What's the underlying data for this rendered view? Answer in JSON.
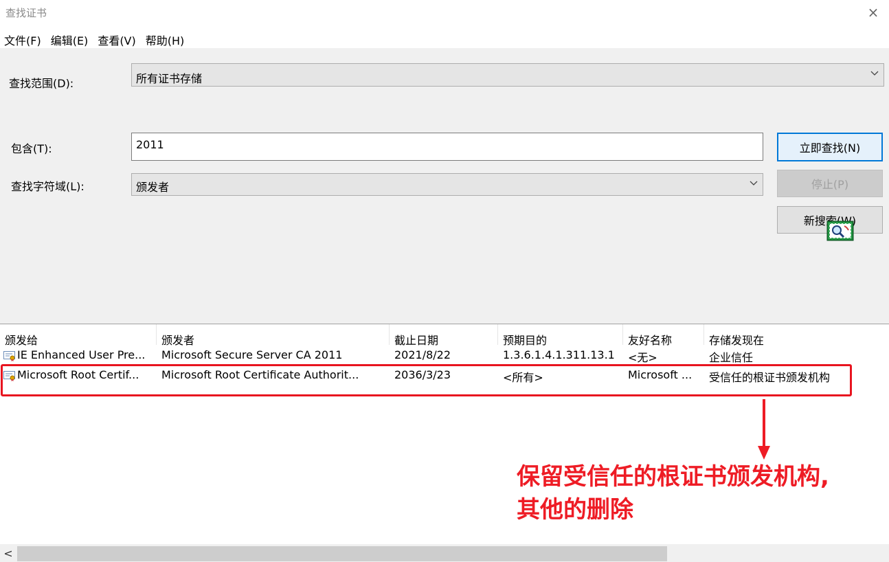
{
  "window": {
    "title": "查找证书",
    "close_glyph": "×"
  },
  "menu": [
    "文件(F)",
    "编辑(E)",
    "查看(V)",
    "帮助(H)"
  ],
  "search": {
    "scope_label": "查找范围(D):",
    "scope_value": "所有证书存储",
    "contains_label": "包含(T):",
    "contains_value": "2011",
    "field_label": "查找字符域(L):",
    "field_value": "颁发者"
  },
  "buttons": {
    "find_now": "立即查找(N)",
    "stop": "停止(P)",
    "new_search": "新搜索(W)"
  },
  "table": {
    "columns": [
      "颁发给",
      "颁发者",
      "截止日期",
      "预期目的",
      "友好名称",
      "存储发现在"
    ],
    "rows": [
      [
        "IE Enhanced User Pre...",
        "Microsoft Secure Server CA 2011",
        "2021/8/22",
        "1.3.6.1.4.1.311.13.1",
        "<无>",
        "企业信任"
      ],
      [
        "Microsoft Root Certif...",
        "Microsoft Root Certificate Authorit...",
        "2036/3/23",
        "<所有>",
        "Microsoft ...",
        "受信任的根证书颁发机构"
      ]
    ]
  },
  "annotation": {
    "line1": "保留受信任的根证书颁发机构,",
    "line2": "其他的删除",
    "color": "#ee1c25"
  },
  "scrollbar": {
    "left_glyph": "<"
  }
}
